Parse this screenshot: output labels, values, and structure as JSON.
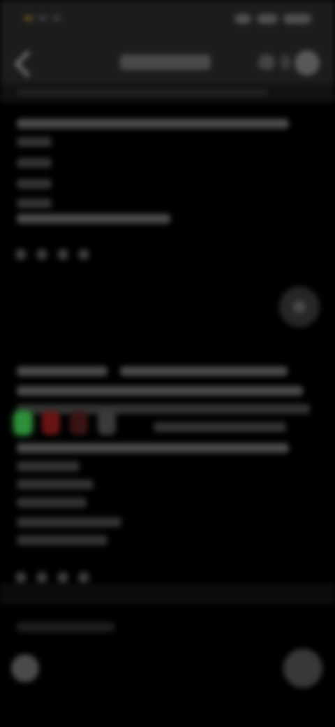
{
  "status_bar": {
    "icons": [
      "notification-icon",
      "signal-icon",
      "wifi-icon",
      "battery-icon"
    ]
  },
  "header": {
    "back_icon": "back-arrow-icon",
    "title": "",
    "actions": [
      "more-icon",
      "avatar"
    ]
  },
  "post": {
    "text": "",
    "reactions": [
      "like-icon",
      "comment-icon",
      "share-icon",
      "save-icon"
    ]
  },
  "second_post": {
    "text": "",
    "swatch_colors": [
      "#2f8f3a",
      "#6a1414",
      "#3a1414",
      "#3a3a3a"
    ],
    "reactions": [
      "like-icon",
      "comment-icon",
      "share-icon",
      "save-icon"
    ]
  },
  "bottom": {
    "left_icon": "menu-icon",
    "right_icon": "compose-icon"
  }
}
